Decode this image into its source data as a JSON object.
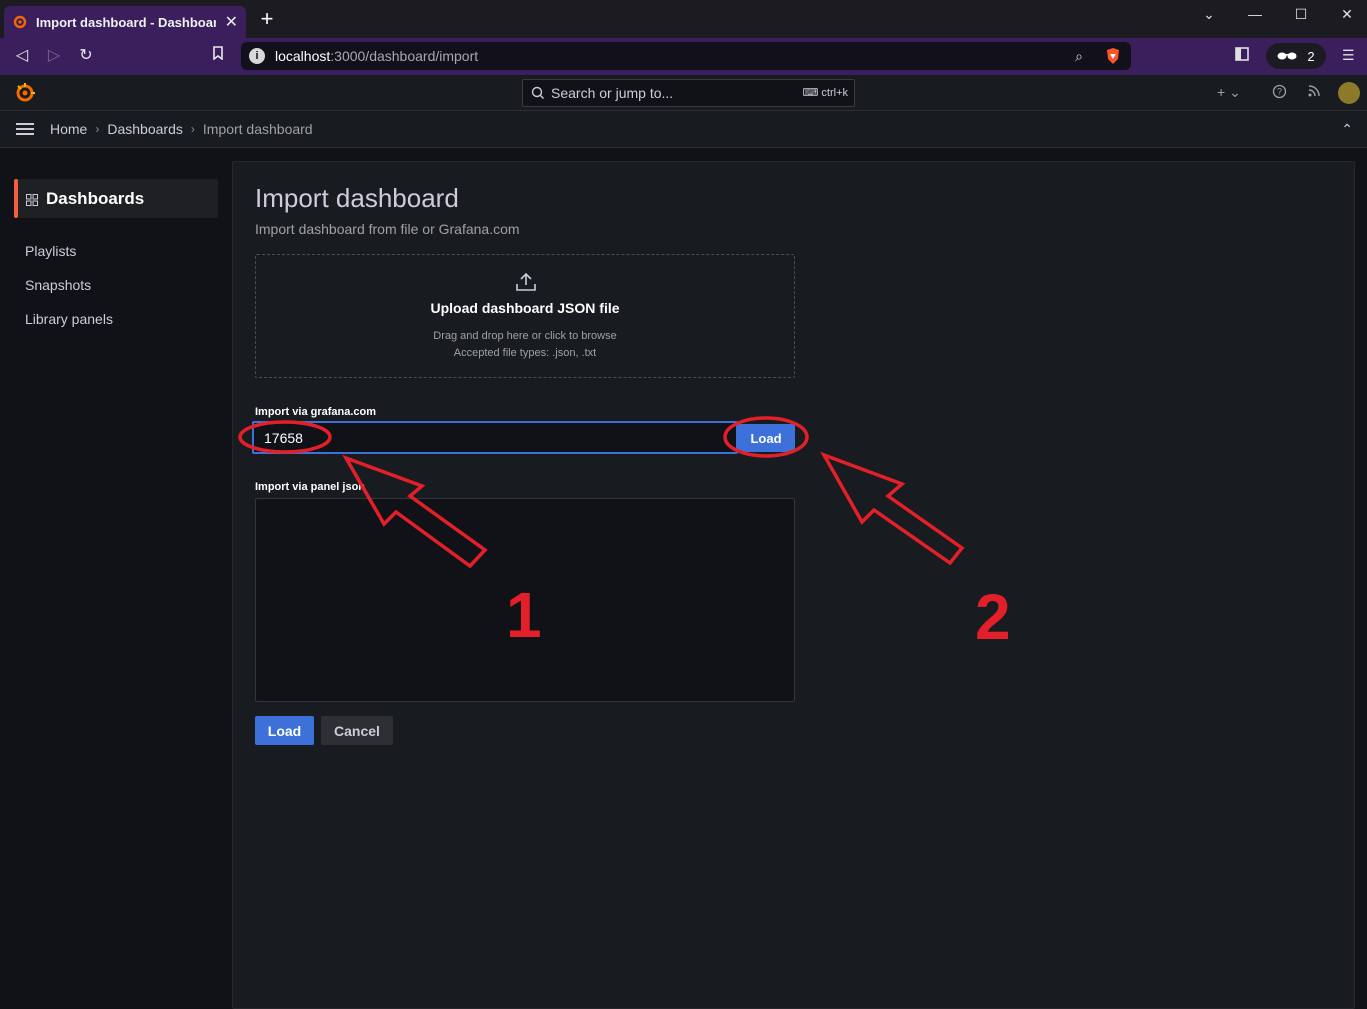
{
  "browser": {
    "tab_title": "Import dashboard - Dashboards - Grafana",
    "new_tab_label": "+",
    "url_host": "localhost",
    "url_path": ":3000/dashboard/import",
    "vpn_count": "2"
  },
  "grafana": {
    "search_placeholder": "Search or jump to...",
    "search_shortcut": "ctrl+k",
    "breadcrumbs": [
      "Home",
      "Dashboards",
      "Import dashboard"
    ],
    "sidebar": {
      "active": "Dashboards",
      "items": [
        "Playlists",
        "Snapshots",
        "Library panels"
      ]
    },
    "page": {
      "title": "Import dashboard",
      "subtitle": "Import dashboard from file or Grafana.com",
      "upload_title": "Upload dashboard JSON file",
      "upload_hint": "Drag and drop here or click to browse",
      "upload_types": "Accepted file types: .json, .txt",
      "grafana_com_label": "Import via grafana.com",
      "grafana_com_value": "17658",
      "grafana_com_load": "Load",
      "panel_json_label": "Import via panel json",
      "panel_json_value": "",
      "load_button": "Load",
      "cancel_button": "Cancel"
    }
  },
  "annotations": {
    "step1": "1",
    "step2": "2",
    "color": "#e3202a"
  }
}
